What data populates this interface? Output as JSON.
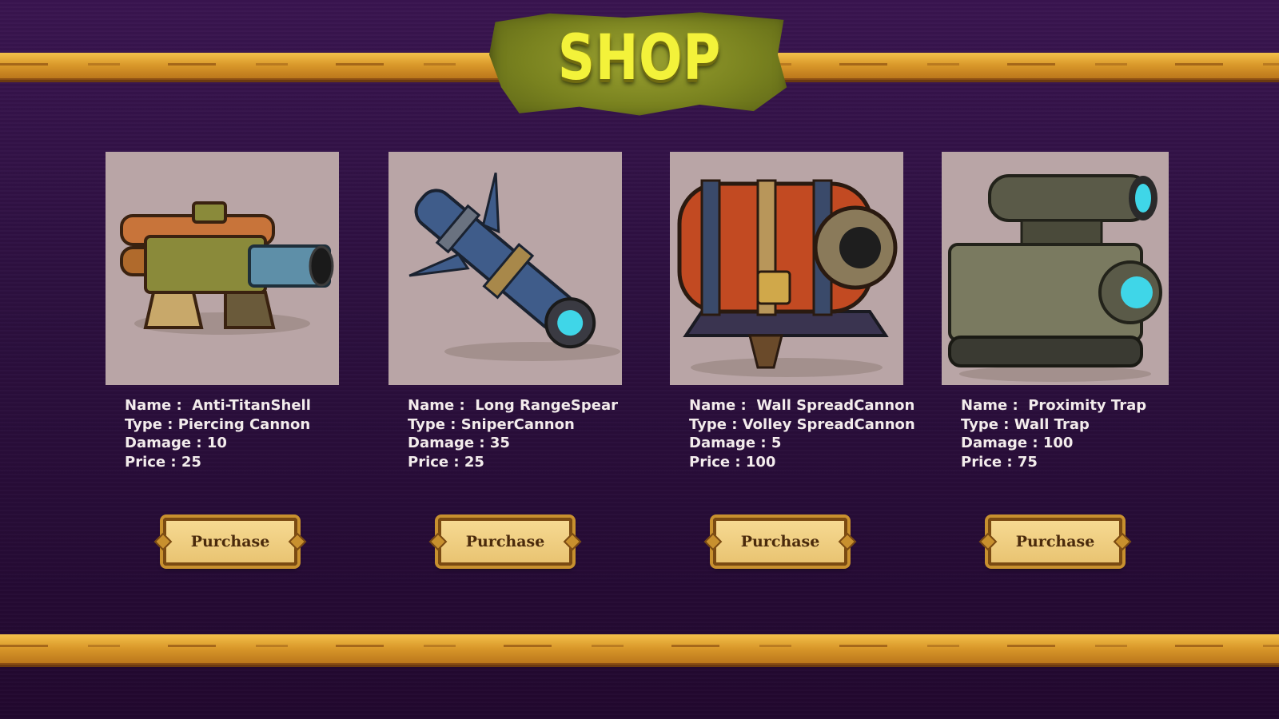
{
  "shop": {
    "title": "SHOP"
  },
  "items": [
    {
      "name_label": "Name :",
      "name": "Anti-TitanShell",
      "type_label": "Type :",
      "type": "Piercing Cannon",
      "damage_label": "Damage :",
      "damage": "10",
      "price_label": "Price :",
      "price": "25",
      "button_label": "Purchase",
      "icon": "cannon-icon"
    },
    {
      "name_label": "Name :",
      "name": "Long RangeSpear",
      "type_label": "Type :",
      "type": "SniperCannon",
      "damage_label": "Damage :",
      "damage": "35",
      "price_label": "Price :",
      "price": "25",
      "button_label": "Purchase",
      "icon": "spear-cannon-icon"
    },
    {
      "name_label": "Name :",
      "name": "Wall SpreadCannon",
      "type_label": "Type :",
      "type": "Volley SpreadCannon",
      "damage_label": "Damage :",
      "damage": "5",
      "price_label": "Price :",
      "price": "100",
      "button_label": "Purchase",
      "icon": "spread-cannon-icon"
    },
    {
      "name_label": "Name :",
      "name": "Proximity Trap",
      "type_label": "Type :",
      "type": "Wall Trap",
      "damage_label": "Damage :",
      "damage": "100",
      "price_label": "Price :",
      "price": "75",
      "button_label": "Purchase",
      "icon": "trap-turret-icon"
    }
  ],
  "colors": {
    "background": "#2d1040",
    "plank": "#d9982a",
    "banner": "#79821f",
    "title": "#f3f23a",
    "card_bg": "#b9a5a6",
    "button": "#e9c472"
  }
}
